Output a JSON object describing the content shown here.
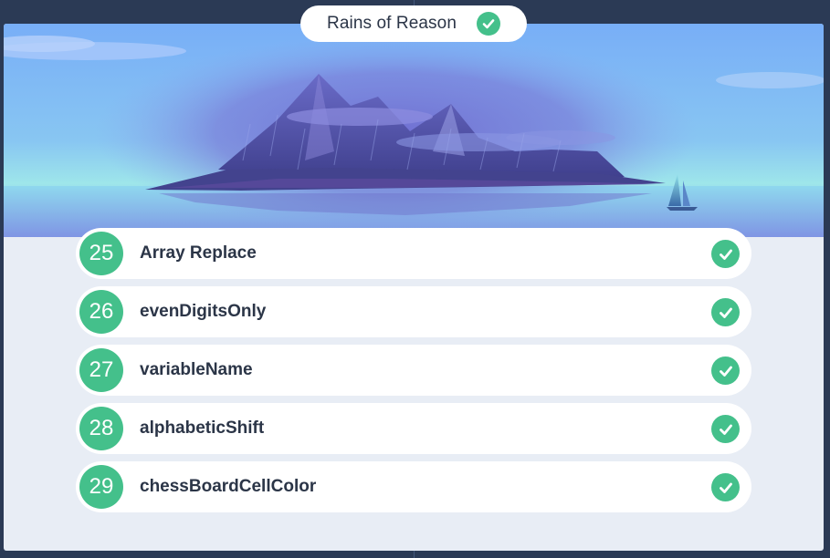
{
  "header": {
    "title": "Rains of Reason",
    "status_icon": "check-circle-icon",
    "completed": true
  },
  "colors": {
    "page_bg": "#2b3a55",
    "card_bg": "#e8edf5",
    "accent_green": "#44c08b",
    "text_dark": "#2b3547",
    "sky_top": "#7fb8ff",
    "sky_mid": "#8ed0f0",
    "island": "#4a4a9a"
  },
  "levels": [
    {
      "number": "25",
      "name": "Array Replace",
      "completed": true,
      "icon": "check-circle-icon"
    },
    {
      "number": "26",
      "name": "evenDigitsOnly",
      "completed": true,
      "icon": "check-circle-icon"
    },
    {
      "number": "27",
      "name": "variableName",
      "completed": true,
      "icon": "check-circle-icon"
    },
    {
      "number": "28",
      "name": "alphabeticShift",
      "completed": true,
      "icon": "check-circle-icon"
    },
    {
      "number": "29",
      "name": "chessBoardCellColor",
      "completed": true,
      "icon": "check-circle-icon"
    }
  ]
}
